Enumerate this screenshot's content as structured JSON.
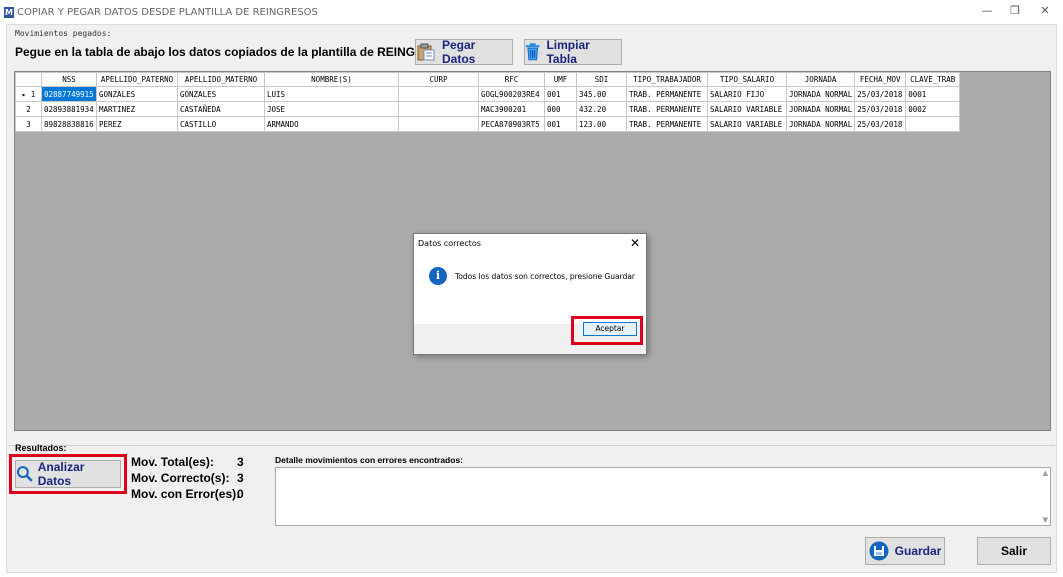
{
  "window": {
    "app_icon": "M",
    "title": "COPIAR Y PEGAR DATOS DESDE PLANTILLA DE REINGRESOS",
    "controls": {
      "minimize": "—",
      "restore": "❐",
      "close": "✕"
    }
  },
  "group_label": "Movimientos pegados:",
  "instructions": "Pegue en la tabla de abajo los datos copiados de la plantilla de REINGRESOS.",
  "buttons": {
    "paste": "Pegar Datos",
    "clear": "Limpiar Tabla",
    "analyze": "Analizar Datos",
    "save": "Guardar",
    "exit": "Salir"
  },
  "table": {
    "columns": [
      "NSS",
      "APELLIDO_PATERNO",
      "APELLIDO_MATERNO",
      "NOMBRE(S)",
      "CURP",
      "RFC",
      "UMF",
      "SDI",
      "TIPO_TRABAJADOR",
      "TIPO_SALARIO",
      "JORNADA",
      "FECHA_MOV",
      "CLAVE_TRAB"
    ],
    "rows": [
      {
        "header": "▸ 1",
        "cells": [
          "02887749915",
          "GONZALES",
          "GONZALES",
          "LUIS",
          "",
          "GOGL900203RE4",
          "001",
          "345.00",
          "TRAB. PERMANENTE",
          "SALARIO FIJO",
          "JORNADA NORMAL",
          "25/03/2018",
          "0001"
        ]
      },
      {
        "header": "2",
        "cells": [
          "02893881934",
          "MARTINEZ",
          "CASTAÑEDA",
          "JOSE",
          "",
          "MAC3900201",
          "000",
          "432.20",
          "TRAB. PERMANENTE",
          "SALARIO VARIABLE",
          "JORNADA NORMAL",
          "25/03/2018",
          "0002"
        ]
      },
      {
        "header": "3",
        "cells": [
          "89828838816",
          "PEREZ",
          "CASTILLO",
          "ARMANDO",
          "",
          "PECA870903RT5",
          "001",
          "123.00",
          "TRAB. PERMANENTE",
          "SALARIO VARIABLE",
          "JORNADA NORMAL",
          "25/03/2018",
          ""
        ]
      }
    ]
  },
  "dialog": {
    "title": "Datos correctos",
    "close": "✕",
    "icon": "info-icon",
    "message": "Todos los datos son correctos, presione Guardar",
    "ok": "Aceptar"
  },
  "results": {
    "title": "Resultados:",
    "total_label": "Mov. Total(es):",
    "total_value": "3",
    "correct_label": "Mov. Correcto(s):",
    "correct_value": "3",
    "error_label": "Mov. con Error(es):",
    "error_value": "0",
    "detail_label": "Detalle movimientos con errores encontrados:"
  },
  "colors": {
    "highlight": "#e0001b",
    "selection": "#0078d7",
    "grid_bg": "#ababab",
    "button_text": "#1a237e"
  }
}
